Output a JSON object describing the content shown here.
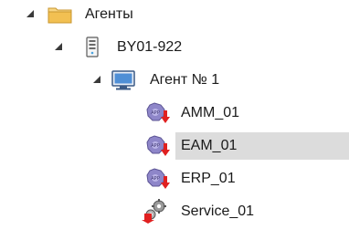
{
  "tree": {
    "root": {
      "label": "Агенты",
      "icon": "folder-icon"
    },
    "server": {
      "label": "BY01-922",
      "icon": "server-icon"
    },
    "agent": {
      "label": "Агент № 1",
      "icon": "monitor-icon"
    },
    "items": [
      {
        "label": "AMM_01",
        "icon": "app-error-icon"
      },
      {
        "label": "EAM_01",
        "icon": "app-error-icon",
        "selected": true
      },
      {
        "label": "ERP_01",
        "icon": "app-error-icon"
      },
      {
        "label": "Service_01",
        "icon": "service-error-icon"
      }
    ]
  },
  "colors": {
    "selection": "#dcdcdc",
    "folder": "#f2c052",
    "error_arrow": "#e02020"
  }
}
